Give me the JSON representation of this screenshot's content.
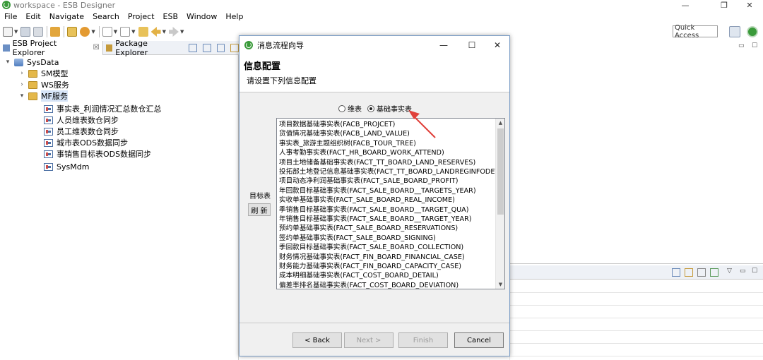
{
  "window": {
    "title": "workspace - ESB Designer",
    "minimize_glyph": "—",
    "restore_glyph": "❐",
    "close_glyph": "✕"
  },
  "menu": [
    "File",
    "Edit",
    "Navigate",
    "Search",
    "Project",
    "ESB",
    "Window",
    "Help"
  ],
  "toolbar": {
    "quick_access_placeholder": "Quick Access"
  },
  "left_panel": {
    "tabs": [
      {
        "label": "ESB Project Explorer",
        "close": "☒"
      },
      {
        "label": "Package Explorer"
      }
    ],
    "tree": [
      {
        "label": "SysData",
        "level": 0,
        "twisty": "▾",
        "icon": "db"
      },
      {
        "label": "SM模型",
        "level": 1,
        "twisty": "›",
        "icon": "folder"
      },
      {
        "label": "WS服务",
        "level": 1,
        "twisty": "›",
        "icon": "folder"
      },
      {
        "label": "MF服务",
        "level": 1,
        "twisty": "▾",
        "icon": "folder",
        "selected": true
      },
      {
        "label": "事实表_利润情况汇总数仓汇总",
        "level": 2,
        "icon": "flow"
      },
      {
        "label": "人员维表数仓同步",
        "level": 2,
        "icon": "flow"
      },
      {
        "label": "员工维表数仓同步",
        "level": 2,
        "icon": "flow"
      },
      {
        "label": "城市表ODS数据同步",
        "level": 2,
        "icon": "flow"
      },
      {
        "label": "事销售目标表ODS数据同步",
        "level": 2,
        "icon": "flow"
      },
      {
        "label": "SysMdm",
        "level": 2,
        "icon": "flow"
      }
    ]
  },
  "dialog": {
    "title": "消息流程向导",
    "header_title": "信息配置",
    "header_subtitle": "请设置下列信息配置",
    "radio_options": [
      {
        "label": "维表",
        "checked": false
      },
      {
        "label": "基础事实表",
        "checked": true
      }
    ],
    "target_label": "目标表",
    "refresh_label": "刷 新",
    "list_items": [
      "项目数据基础事实表(FACB_PROJCET)",
      "货值情况基础事实表(FACB_LAND_VALUE)",
      "事实表_旅游主题组织树(FACB_TOUR_TREE)",
      "人事考勤事实表(FACT_HR_BOARD_WORK_ATTEND)",
      "项目土地储备基础事实表(FACT_TT_BOARD_LAND_RESERVES)",
      "投拓部土地登记信息基础事实表(FACT_TT_BOARD_LANDREGINFODEVI",
      "项目动态净利润基础事实表(FACT_SALE_BOARD_PROFIT)",
      "年回款目标基础事实表(FACT_SALE_BOARD__TARGETS_YEAR)",
      "实收单基础事实表(FACT_SALE_BOARD_REAL_INCOME)",
      "季销售目标基础事实表(FACT_SALE_BOARD__TARGET_QUA)",
      "年销售目标基础事实表(FACT_SALE_BOARD__TARGET_YEAR)",
      "预约单基础事实表(FACT_SALE_BOARD_RESERVATIONS)",
      "签约单基础事实表(FACT_SALE_BOARD_SIGNING)",
      "季回款目标基础事实表(FACT_SALE_BOARD_COLLECTION)",
      "财务情况基础事实表(FACT_FIN_BOARD_FINANCIAL_CASE)",
      "财务能力基础事实表(FACT_FIN_BOARD_CAPACITY_CASE)",
      "成本明细基础事实表(FACT_COST_BOARD_DETAIL)",
      "偏差率排名基础事实表(FACT_COST_BOARD_DEVIATION)"
    ],
    "buttons": {
      "back": "< Back",
      "next": "Next >",
      "finish": "Finish",
      "cancel": "Cancel"
    },
    "title_controls": {
      "minimize": "—",
      "maximize": "☐",
      "close": "✕"
    }
  },
  "colors": {
    "accent_arrow": "#e0403a",
    "app_green": "#3a9a3a"
  }
}
